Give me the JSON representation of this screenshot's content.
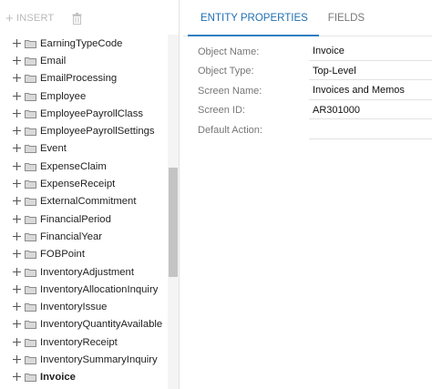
{
  "toolbar": {
    "insert_label": "INSERT",
    "plus_icon": "plus-icon",
    "delete_icon": "trash-icon"
  },
  "tree": {
    "items": [
      {
        "label": "EarningTypeCode",
        "bold": false
      },
      {
        "label": "Email",
        "bold": false
      },
      {
        "label": "EmailProcessing",
        "bold": false
      },
      {
        "label": "Employee",
        "bold": false
      },
      {
        "label": "EmployeePayrollClass",
        "bold": false
      },
      {
        "label": "EmployeePayrollSettings",
        "bold": false
      },
      {
        "label": "Event",
        "bold": false
      },
      {
        "label": "ExpenseClaim",
        "bold": false
      },
      {
        "label": "ExpenseReceipt",
        "bold": false
      },
      {
        "label": "ExternalCommitment",
        "bold": false
      },
      {
        "label": "FinancialPeriod",
        "bold": false
      },
      {
        "label": "FinancialYear",
        "bold": false
      },
      {
        "label": "FOBPoint",
        "bold": false
      },
      {
        "label": "InventoryAdjustment",
        "bold": false
      },
      {
        "label": "InventoryAllocationInquiry",
        "bold": false
      },
      {
        "label": "InventoryIssue",
        "bold": false
      },
      {
        "label": "InventoryQuantityAvailable",
        "bold": false
      },
      {
        "label": "InventoryReceipt",
        "bold": false
      },
      {
        "label": "InventorySummaryInquiry",
        "bold": false
      },
      {
        "label": "Invoice",
        "bold": true
      }
    ]
  },
  "tabs": [
    {
      "label": "ENTITY PROPERTIES",
      "active": true
    },
    {
      "label": "FIELDS",
      "active": false
    }
  ],
  "form": {
    "fields": [
      {
        "label": "Object Name:",
        "value": "Invoice"
      },
      {
        "label": "Object Type:",
        "value": "Top-Level"
      },
      {
        "label": "Screen Name:",
        "value": "Invoices and Memos"
      },
      {
        "label": "Screen ID:",
        "value": "AR301000"
      },
      {
        "label": "Default Action:",
        "value": ""
      }
    ]
  },
  "colors": {
    "accent": "#2e7dc1",
    "folder_fill": "#d9d9d9",
    "folder_stroke": "#8c8c8c"
  }
}
